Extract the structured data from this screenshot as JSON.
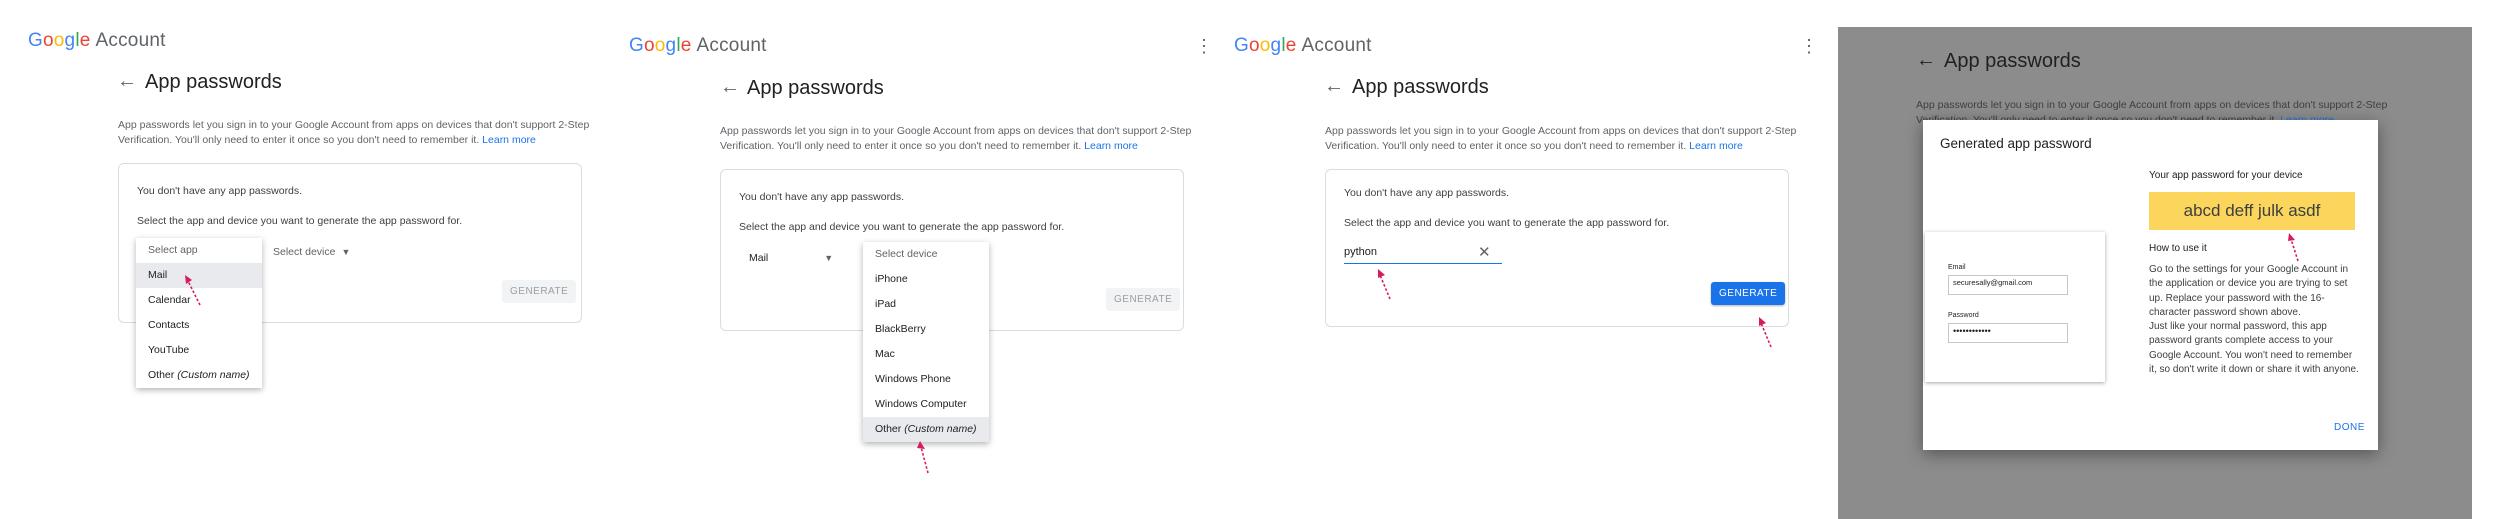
{
  "header": {
    "logo_google": [
      "G",
      "o",
      "o",
      "g",
      "l",
      "e"
    ],
    "logo_account": "Account",
    "menu_icon": "more-vert-icon"
  },
  "page": {
    "title": "App passwords",
    "description_1": "App passwords let you sign in to your Google Account from apps on devices that don't support 2-Step",
    "description_2": "Verification. You'll only need to enter it once so you don't need to remember it.",
    "learn_more": "Learn more",
    "no_passwords": "You don't have any app passwords.",
    "select_instruction": "Select the app and device you want to generate the app password for.",
    "generate_label": "GENERATE"
  },
  "step1": {
    "app_select_placeholder": "Select app",
    "device_select_placeholder": "Select device",
    "app_options": [
      "Mail",
      "Calendar",
      "Contacts",
      "YouTube"
    ],
    "other_prefix": "Other",
    "other_suffix": "(Custom name)"
  },
  "step2": {
    "selected_app": "Mail",
    "device_header": "Select device",
    "device_options": [
      "iPhone",
      "iPad",
      "BlackBerry",
      "Mac",
      "Windows Phone",
      "Windows Computer"
    ],
    "other_prefix": "Other",
    "other_suffix": "(Custom name)"
  },
  "step3": {
    "custom_name_value": "python"
  },
  "modal": {
    "title": "Generated app password",
    "password_heading": "Your app password for your device",
    "password_value": "abcd deff julk asdf",
    "how_heading": "How to use it",
    "how_text_1": "Go to the settings for your Google Account in the application or device you are trying to set up. Replace your password with the 16-character password shown above.",
    "how_text_2": "Just like your normal password, this app password grants complete access to your Google Account. You won't need to remember it, so don't write it down or share it with anyone.",
    "email_label": "Email",
    "email_value": "securesally@gmail.com",
    "password_label": "Password",
    "password_dots": "••••••••••••",
    "done_label": "DONE"
  },
  "colors": {
    "accent": "#1a73e8",
    "highlight_password_box": "#fcd55c",
    "annotation_arrow": "#d81b60",
    "overlay": "#8c8c8c"
  }
}
